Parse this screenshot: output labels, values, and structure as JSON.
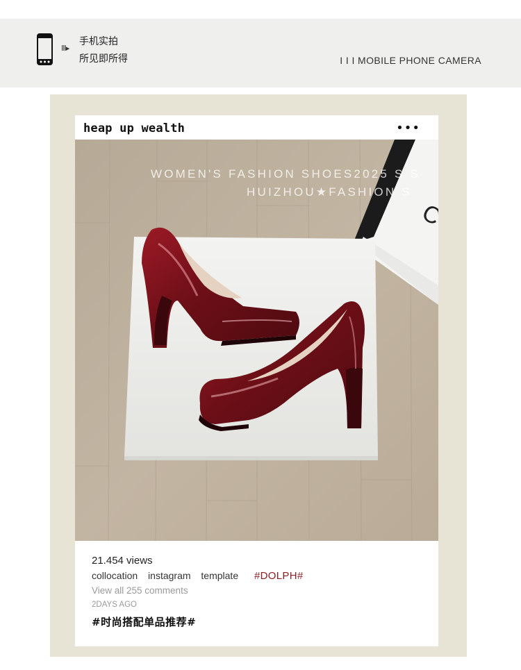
{
  "banner": {
    "line1": "手机实拍",
    "line2": "所见即所得",
    "arrow_text": "III▸",
    "tagline": "I I I  MOBILE PHONE CAMERA",
    "phone_icon": "phone-icon",
    "bg_color": "#efefed"
  },
  "post": {
    "username": "heap up wealth",
    "more_icon": "more-horizontal-icon",
    "overlay_line1": "WOMEN'S FASHION SHOES2025 S S",
    "overlay_line2": "HUIZHOU★FASHION S",
    "bag_text": "C",
    "views": "21.454 views",
    "tags": [
      "collocation",
      "instagram",
      "template"
    ],
    "hashtag": "#DOLPH#",
    "comments_link": "View all 255 comments",
    "time_ago": "2DAYS AGO",
    "cn_hashtag": "#时尚搭配单品推荐#",
    "accent_color": "#8b1f24",
    "frame_color": "#e7e3d5"
  }
}
